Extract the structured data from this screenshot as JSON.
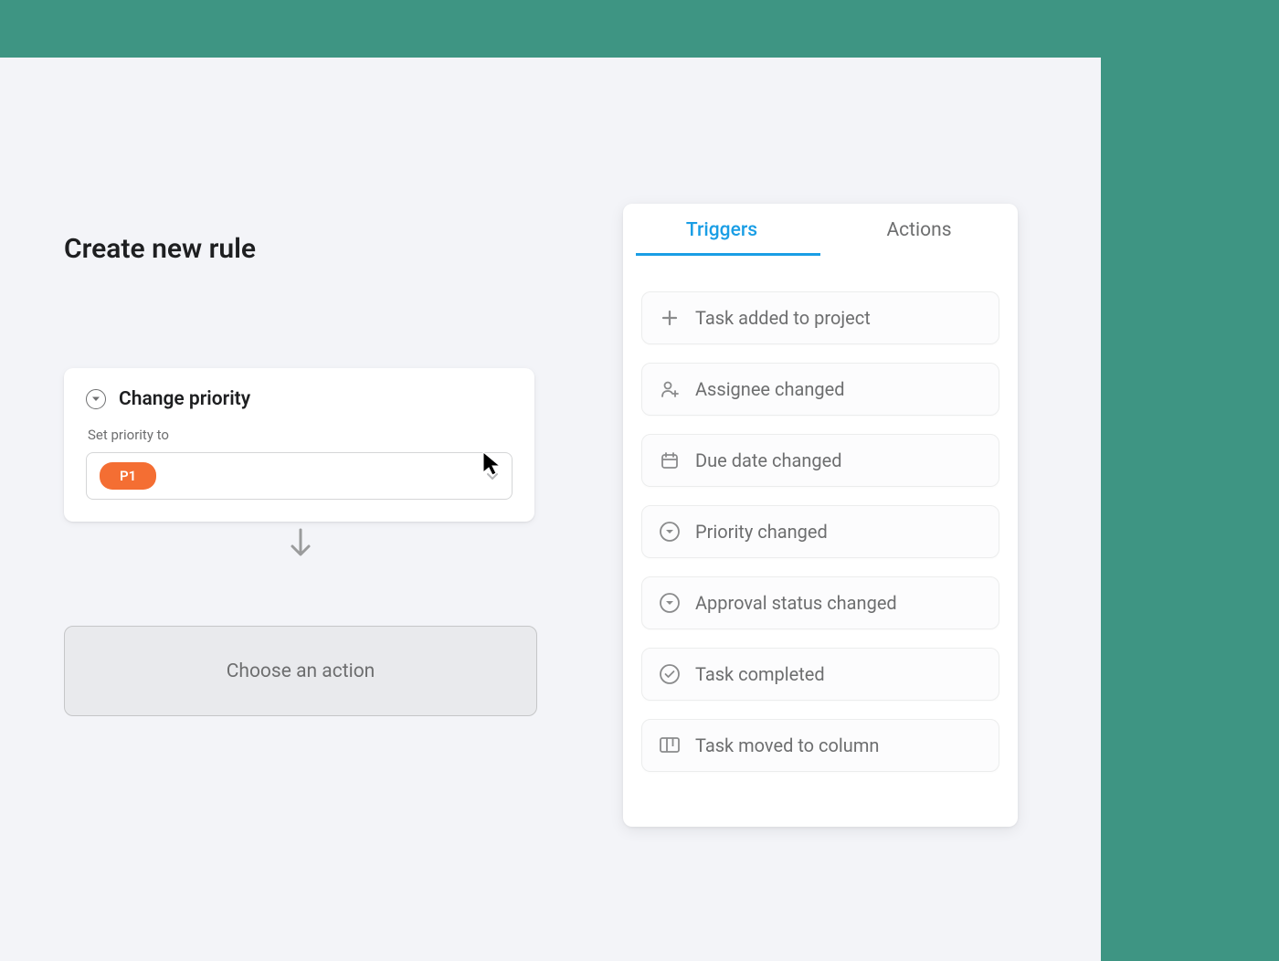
{
  "page_title": "Create new rule",
  "rule_card": {
    "title": "Change priority",
    "field_label": "Set priority to",
    "selected_value": "P1"
  },
  "action_placeholder": "Choose an action",
  "tabs": {
    "triggers": "Triggers",
    "actions": "Actions",
    "active": "triggers"
  },
  "triggers": [
    {
      "icon": "plus",
      "label": "Task added to project"
    },
    {
      "icon": "user-plus",
      "label": "Assignee changed"
    },
    {
      "icon": "calendar",
      "label": "Due date changed"
    },
    {
      "icon": "dropdown-circle",
      "label": "Priority changed"
    },
    {
      "icon": "dropdown-circle",
      "label": "Approval status changed"
    },
    {
      "icon": "check-circle",
      "label": "Task completed"
    },
    {
      "icon": "columns",
      "label": "Task moved to column"
    }
  ],
  "colors": {
    "brand_teal": "#3e9583",
    "accent_blue": "#1a9ee5",
    "priority_orange": "#f46e33",
    "bg_light": "#f3f4f8",
    "text_dark": "#1e1f21",
    "text_muted": "#6d6e6f"
  }
}
